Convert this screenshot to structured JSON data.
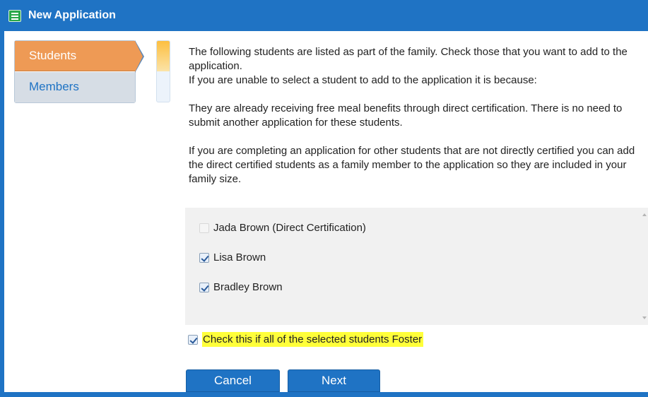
{
  "window": {
    "title": "New Application",
    "accent_color": "#1f73c4"
  },
  "sidebar": {
    "tabs": [
      {
        "label": "Students",
        "active": true
      },
      {
        "label": "Members",
        "active": false
      }
    ]
  },
  "progress": {
    "value": 0.5
  },
  "instructions": {
    "p1": "The following students are listed as part of the family. Check those that you want to add to the application.",
    "p2": "If you are unable to select a student to add to the application it is because:",
    "p3": "They are already receiving free meal benefits through direct certification. There is no need to submit another application for these students.",
    "p4": "If you are completing an application for other students that are not directly certified you can add the direct certified students as a family member to the application so they are included in your family size."
  },
  "students": [
    {
      "name": "Jada Brown (Direct Certification)",
      "checked": false,
      "disabled": true
    },
    {
      "name": "Lisa Brown",
      "checked": true,
      "disabled": false
    },
    {
      "name": "Bradley Brown",
      "checked": true,
      "disabled": false
    }
  ],
  "foster": {
    "label": "Check this if all of the selected students Foster",
    "checked": true,
    "highlight_color": "#ffff3a"
  },
  "buttons": {
    "cancel": "Cancel",
    "next": "Next"
  }
}
